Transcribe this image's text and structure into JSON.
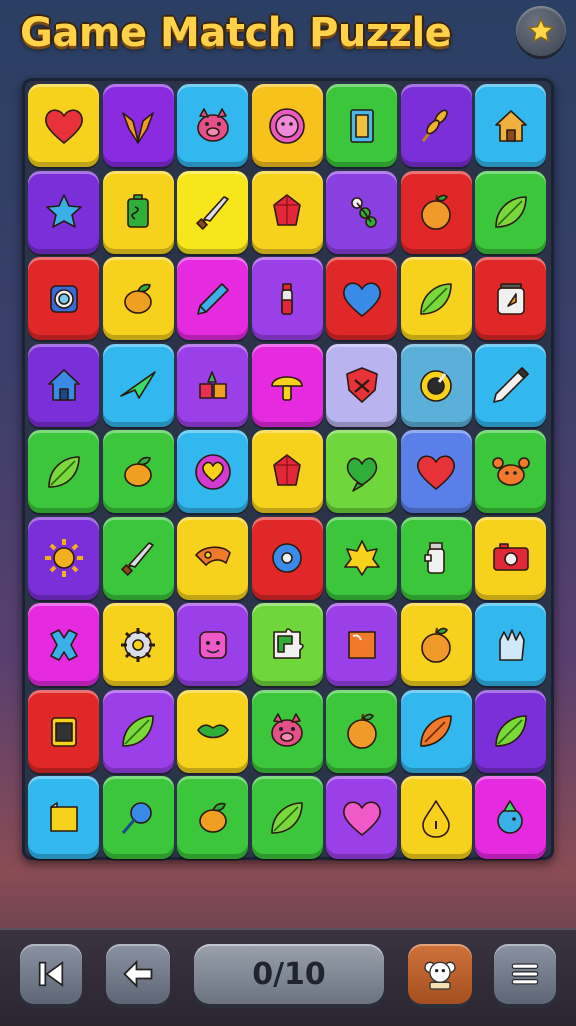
{
  "header": {
    "title": "Game Match Puzzle",
    "star_icon": "star-icon"
  },
  "board": {
    "rows": [
      [
        {
          "bg": "#f7d21c",
          "icon": "heart"
        },
        {
          "bg": "#8a2be2",
          "icon": "fox"
        },
        {
          "bg": "#33b7ef",
          "icon": "pig"
        },
        {
          "bg": "#f7c21c",
          "icon": "sun-face"
        },
        {
          "bg": "#3cc63c",
          "icon": "card"
        },
        {
          "bg": "#7b2fd8",
          "icon": "wheat"
        },
        {
          "bg": "#33b7ef",
          "icon": "house"
        }
      ],
      [
        {
          "bg": "#7b2fd8",
          "icon": "star"
        },
        {
          "bg": "#f7d21c",
          "icon": "battery"
        },
        {
          "bg": "#f7e61c",
          "icon": "sword"
        },
        {
          "bg": "#f7d21c",
          "icon": "gem"
        },
        {
          "bg": "#8a3fe0",
          "icon": "beads"
        },
        {
          "bg": "#e02828",
          "icon": "apple"
        },
        {
          "bg": "#3cc63c",
          "icon": "leaf"
        }
      ],
      [
        {
          "bg": "#e02828",
          "icon": "camera-lens"
        },
        {
          "bg": "#f7d21c",
          "icon": "fruit"
        },
        {
          "bg": "#e62ae0",
          "icon": "pencil"
        },
        {
          "bg": "#9b3fe8",
          "icon": "bottle"
        },
        {
          "bg": "#e02828",
          "icon": "heart-blue"
        },
        {
          "bg": "#f7d21c",
          "icon": "leaf"
        },
        {
          "bg": "#e02828",
          "icon": "jar"
        }
      ],
      [
        {
          "bg": "#7b2fd8",
          "icon": "house-blue"
        },
        {
          "bg": "#33b7ef",
          "icon": "plane"
        },
        {
          "bg": "#9b3fe8",
          "icon": "blocks"
        },
        {
          "bg": "#e62ae0",
          "icon": "mushroom"
        },
        {
          "bg": "#b9b3f0",
          "icon": "shield"
        },
        {
          "bg": "#5ab0d8",
          "icon": "ring"
        },
        {
          "bg": "#33b7ef",
          "icon": "pen"
        }
      ],
      [
        {
          "bg": "#3cc63c",
          "icon": "leaf"
        },
        {
          "bg": "#3cc63c",
          "icon": "fruit"
        },
        {
          "bg": "#33b7ef",
          "icon": "heart-bubble"
        },
        {
          "bg": "#f7d21c",
          "icon": "gem"
        },
        {
          "bg": "#6fd63c",
          "icon": "heart-bubble-green"
        },
        {
          "bg": "#5a7fe8",
          "icon": "heart"
        },
        {
          "bg": "#3cc63c",
          "icon": "crab"
        }
      ],
      [
        {
          "bg": "#7b2fd8",
          "icon": "sun"
        },
        {
          "bg": "#3cc63c",
          "icon": "sword"
        },
        {
          "bg": "#f7d21c",
          "icon": "horn"
        },
        {
          "bg": "#e02828",
          "icon": "flower"
        },
        {
          "bg": "#3cc63c",
          "icon": "star-sun"
        },
        {
          "bg": "#3cc63c",
          "icon": "hydrant"
        },
        {
          "bg": "#f7d21c",
          "icon": "camera"
        }
      ],
      [
        {
          "bg": "#e62ae0",
          "icon": "cross"
        },
        {
          "bg": "#f7d21c",
          "icon": "gear"
        },
        {
          "bg": "#9b3fe8",
          "icon": "face"
        },
        {
          "bg": "#6fd63c",
          "icon": "puzzle"
        },
        {
          "bg": "#9b3fe8",
          "icon": "box"
        },
        {
          "bg": "#f7d21c",
          "icon": "apple"
        },
        {
          "bg": "#33b7ef",
          "icon": "glove"
        }
      ],
      [
        {
          "bg": "#e02828",
          "icon": "battery-dark"
        },
        {
          "bg": "#9b3fe8",
          "icon": "leaf"
        },
        {
          "bg": "#f7d21c",
          "icon": "lips"
        },
        {
          "bg": "#3cc63c",
          "icon": "pig"
        },
        {
          "bg": "#3cc63c",
          "icon": "apple"
        },
        {
          "bg": "#33b7ef",
          "icon": "seed"
        },
        {
          "bg": "#7b2fd8",
          "icon": "leaf"
        }
      ],
      [
        {
          "bg": "#33b7ef",
          "icon": "note"
        },
        {
          "bg": "#3cc63c",
          "icon": "flower-blue"
        },
        {
          "bg": "#3cc63c",
          "icon": "fruit"
        },
        {
          "bg": "#3cc63c",
          "icon": "leaf"
        },
        {
          "bg": "#9b3fe8",
          "icon": "heart-pink"
        },
        {
          "bg": "#f7d21c",
          "icon": "drop"
        },
        {
          "bg": "#e62ae0",
          "icon": "bird"
        }
      ]
    ]
  },
  "toolbar": {
    "buttons": [
      {
        "name": "skip-back-button",
        "icon": "skip-back-icon"
      },
      {
        "name": "back-button",
        "icon": "arrow-left-icon"
      },
      {
        "name": "hint-button",
        "icon": "monkey-icon",
        "color": "#c0602a"
      },
      {
        "name": "menu-button",
        "icon": "menu-icon"
      }
    ],
    "score": "0/10"
  }
}
